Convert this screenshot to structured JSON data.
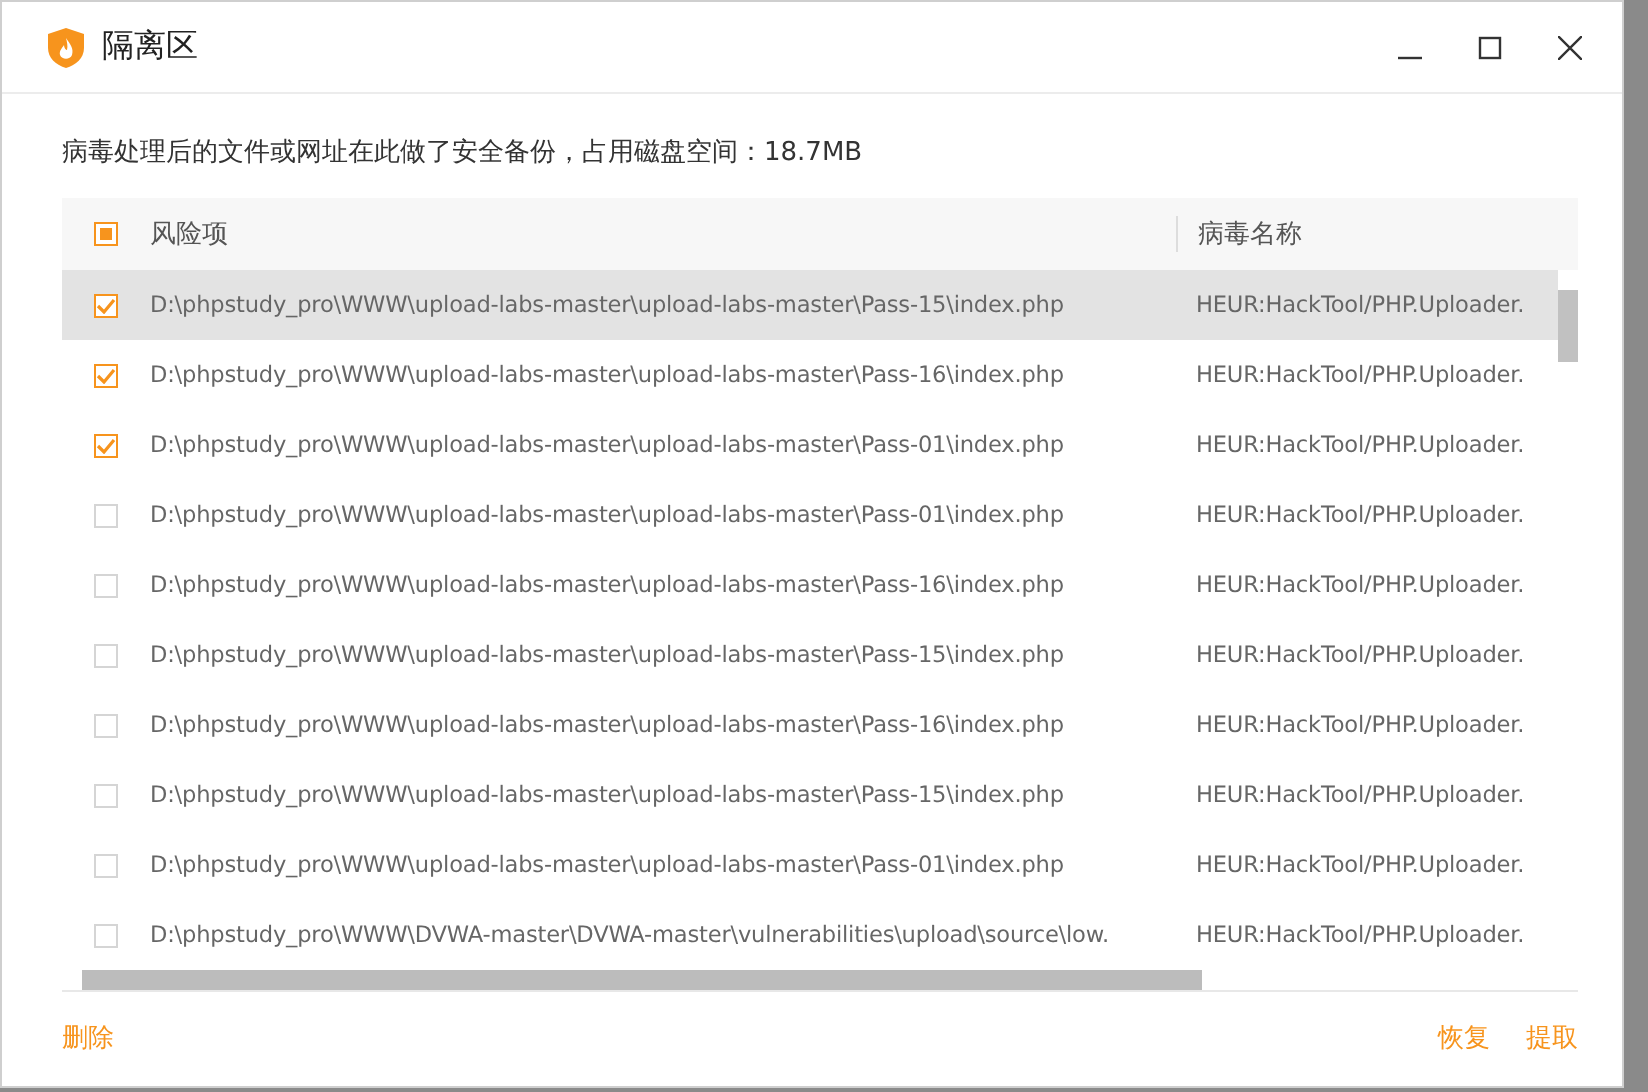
{
  "window": {
    "title": "隔离区"
  },
  "description": "病毒处理后的文件或网址在此做了安全备份，占用磁盘空间：18.7MB",
  "table": {
    "header_checkbox": {
      "indeterminate": true
    },
    "columns": [
      "风险项",
      "病毒名称"
    ],
    "rows": [
      {
        "path": "D:\\phpstudy_pro\\WWW\\upload-labs-master\\upload-labs-master\\Pass-15\\index.php",
        "virus": "HEUR:HackTool/PHP.Uploader.",
        "checked": true,
        "selected": true
      },
      {
        "path": "D:\\phpstudy_pro\\WWW\\upload-labs-master\\upload-labs-master\\Pass-16\\index.php",
        "virus": "HEUR:HackTool/PHP.Uploader.",
        "checked": true,
        "selected": false
      },
      {
        "path": "D:\\phpstudy_pro\\WWW\\upload-labs-master\\upload-labs-master\\Pass-01\\index.php",
        "virus": "HEUR:HackTool/PHP.Uploader.",
        "checked": true,
        "selected": false
      },
      {
        "path": "D:\\phpstudy_pro\\WWW\\upload-labs-master\\upload-labs-master\\Pass-01\\index.php",
        "virus": "HEUR:HackTool/PHP.Uploader.",
        "checked": false,
        "selected": false
      },
      {
        "path": "D:\\phpstudy_pro\\WWW\\upload-labs-master\\upload-labs-master\\Pass-16\\index.php",
        "virus": "HEUR:HackTool/PHP.Uploader.",
        "checked": false,
        "selected": false
      },
      {
        "path": "D:\\phpstudy_pro\\WWW\\upload-labs-master\\upload-labs-master\\Pass-15\\index.php",
        "virus": "HEUR:HackTool/PHP.Uploader.",
        "checked": false,
        "selected": false
      },
      {
        "path": "D:\\phpstudy_pro\\WWW\\upload-labs-master\\upload-labs-master\\Pass-16\\index.php",
        "virus": "HEUR:HackTool/PHP.Uploader.",
        "checked": false,
        "selected": false
      },
      {
        "path": "D:\\phpstudy_pro\\WWW\\upload-labs-master\\upload-labs-master\\Pass-15\\index.php",
        "virus": "HEUR:HackTool/PHP.Uploader.",
        "checked": false,
        "selected": false
      },
      {
        "path": "D:\\phpstudy_pro\\WWW\\upload-labs-master\\upload-labs-master\\Pass-01\\index.php",
        "virus": "HEUR:HackTool/PHP.Uploader.",
        "checked": false,
        "selected": false
      },
      {
        "path": "D:\\phpstudy_pro\\WWW\\DVWA-master\\DVWA-master\\vulnerabilities\\upload\\source\\low.",
        "virus": "HEUR:HackTool/PHP.Uploader.",
        "checked": false,
        "selected": false
      }
    ]
  },
  "footer": {
    "left_actions": [
      "删除"
    ],
    "right_actions": [
      "恢复",
      "提取"
    ]
  }
}
